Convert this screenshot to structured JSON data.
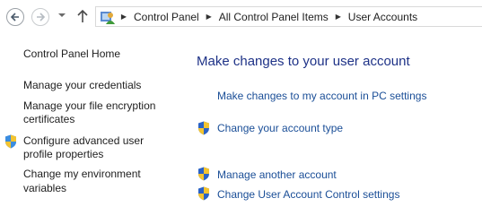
{
  "address_bar": {
    "breadcrumbs": [
      "Control Panel",
      "All Control Panel Items",
      "User Accounts"
    ]
  },
  "left_nav": {
    "home": "Control Panel Home",
    "credentials": "Manage your credentials",
    "encryption_line1": "Manage your file encryption",
    "encryption_line2": "certificates",
    "profile_line1": "Configure advanced user",
    "profile_line2": "profile properties",
    "env_line1": "Change my environment",
    "env_line2": "variables"
  },
  "main": {
    "title": "Make changes to your user account",
    "pc_settings": "Make changes to my account in PC settings",
    "account_type": "Change your account type",
    "manage_another": "Manage another account",
    "uac": "Change User Account Control settings"
  }
}
